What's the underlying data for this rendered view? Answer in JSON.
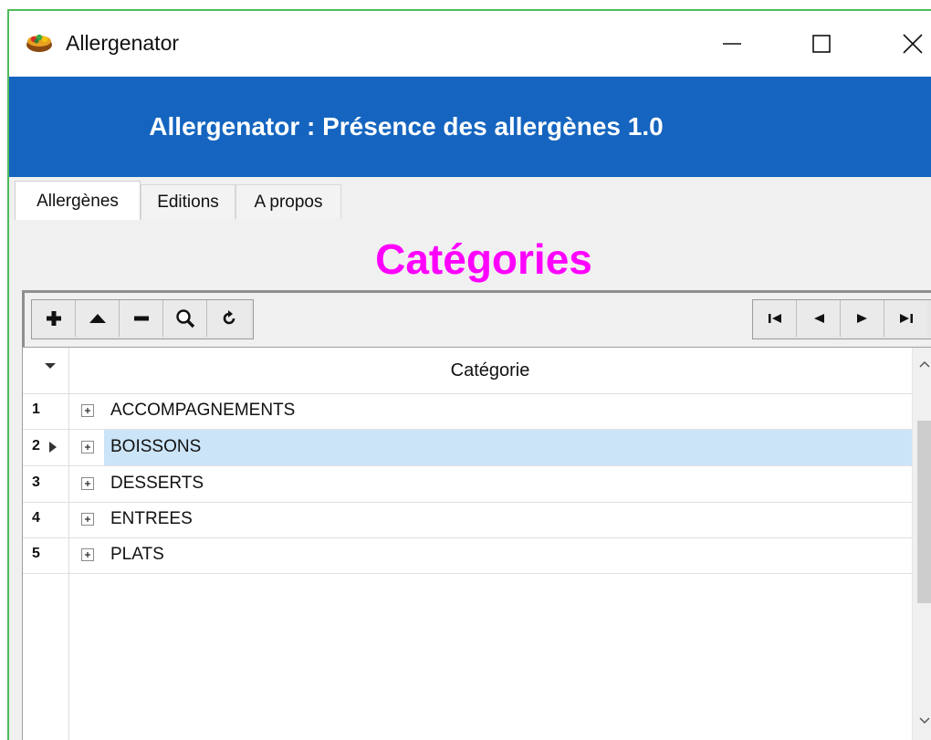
{
  "window": {
    "title": "Allergenator",
    "controls": {
      "minimize": "minimize-icon",
      "maximize": "maximize-icon",
      "close": "close-icon"
    }
  },
  "banner": {
    "text": "Allergenator : Présence des allergènes 1.0",
    "color": "#1565c0"
  },
  "tabs": [
    {
      "label": "Allergènes",
      "active": true
    },
    {
      "label": "Editions",
      "active": false
    },
    {
      "label": "A propos",
      "active": false
    }
  ],
  "heading": {
    "text": "Catégories",
    "color": "#ff00ff"
  },
  "toolbar": {
    "left": [
      "add-icon",
      "move-up-icon",
      "remove-icon",
      "search-icon",
      "refresh-icon"
    ],
    "right": [
      "first-icon",
      "prev-icon",
      "next-icon",
      "last-icon"
    ]
  },
  "grid": {
    "column_header": "Catégorie",
    "rows": [
      {
        "num": "1",
        "label": "ACCOMPAGNEMENTS",
        "selected": false
      },
      {
        "num": "2",
        "label": "BOISSONS",
        "selected": true
      },
      {
        "num": "3",
        "label": "DESSERTS",
        "selected": false
      },
      {
        "num": "4",
        "label": "ENTREES",
        "selected": false
      },
      {
        "num": "5",
        "label": "PLATS",
        "selected": false
      }
    ]
  },
  "colors": {
    "selection": "#cce4f7",
    "window_border": "#4dbb5a"
  }
}
